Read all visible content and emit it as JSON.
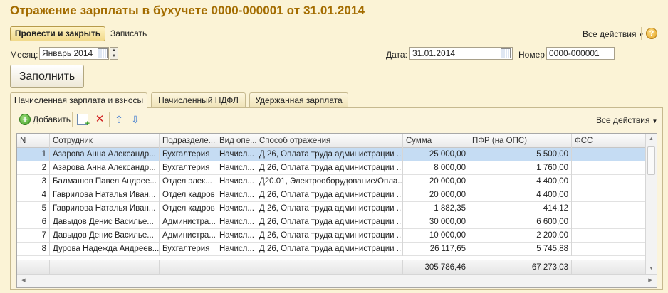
{
  "title": "Отражение зарплаты в бухучете 0000-000001 от 31.01.2014",
  "toolbar": {
    "post_close": "Провести и закрыть",
    "write": "Записать",
    "all_actions": "Все действия",
    "help": "?"
  },
  "form": {
    "month_label": "Месяц:",
    "month_value": "Январь 2014",
    "date_label": "Дата:",
    "date_value": "31.01.2014",
    "number_label": "Номер:",
    "number_value": "0000-000001"
  },
  "fill_button": "Заполнить",
  "tabs": [
    {
      "label": "Начисленная зарплата и взносы",
      "active": true
    },
    {
      "label": "Начисленный НДФЛ",
      "active": false
    },
    {
      "label": "Удержанная зарплата",
      "active": false
    }
  ],
  "table_toolbar": {
    "add": "Добавить",
    "all_actions": "Все действия"
  },
  "table": {
    "columns": [
      "N",
      "Сотрудник",
      "Подразделе...",
      "Вид опе...",
      "Способ отражения",
      "Сумма",
      "ПФР (на ОПС)",
      "ФСС"
    ],
    "rows": [
      [
        "1",
        "Азарова Анна Александр...",
        "Бухгалтерия",
        "Начисл...",
        "Д 26, Оплата труда администрации ...",
        "25 000,00",
        "5 500,00",
        ""
      ],
      [
        "2",
        "Азарова Анна Александр...",
        "Бухгалтерия",
        "Начисл...",
        "Д 26, Оплата труда администрации ...",
        "8 000,00",
        "1 760,00",
        ""
      ],
      [
        "3",
        "Балмашов Павел Андрее...",
        "Отдел элек...",
        "Начисл...",
        "Д20.01, Электрооборудование/Опла...",
        "20 000,00",
        "4 400,00",
        ""
      ],
      [
        "4",
        "Гаврилова Наталья Иван...",
        "Отдел кадров",
        "Начисл...",
        "Д 26, Оплата труда администрации ...",
        "20 000,00",
        "4 400,00",
        ""
      ],
      [
        "5",
        "Гаврилова Наталья Иван...",
        "Отдел кадров",
        "Начисл...",
        "Д 26, Оплата труда администрации ...",
        "1 882,35",
        "414,12",
        ""
      ],
      [
        "6",
        "Давыдов Денис Василье...",
        "Администра...",
        "Начисл...",
        "Д 26, Оплата труда администрации ...",
        "30 000,00",
        "6 600,00",
        ""
      ],
      [
        "7",
        "Давыдов Денис Василье...",
        "Администра...",
        "Начисл...",
        "Д 26, Оплата труда администрации ...",
        "10 000,00",
        "2 200,00",
        ""
      ],
      [
        "8",
        "Дурова Надежда Андреев...",
        "Бухгалтерия",
        "Начисл...",
        "Д 26, Оплата труда администрации ...",
        "26 117,65",
        "5 745,88",
        ""
      ]
    ],
    "totals": {
      "sum": "305 786,46",
      "pfr": "67 273,03"
    }
  },
  "icons": {
    "calendar": "calendar-icon",
    "spin": "spin-icon",
    "add": "plus-circle-icon",
    "copy": "copy-icon",
    "delete": "delete-icon",
    "move_up": "arrow-up-icon",
    "move_down": "arrow-down-icon",
    "help": "help-icon"
  },
  "colors": {
    "title": "#a36c00",
    "selected_row": "#c5dcf3",
    "background": "#fbf3d6"
  }
}
